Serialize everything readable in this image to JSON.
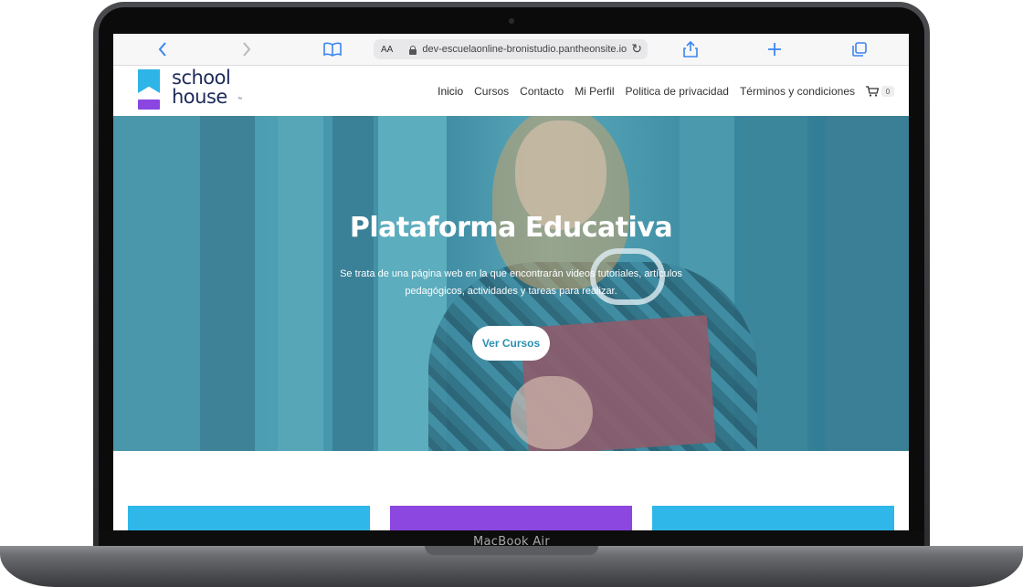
{
  "device": {
    "label": "MacBook Air"
  },
  "browser": {
    "text_size_label": "AA",
    "url": "dev-escuelaonline-bronistudio.pantheonsite.io"
  },
  "site": {
    "logo": {
      "line1": "school",
      "line2": "house",
      "tm": "™"
    },
    "nav": {
      "items": [
        {
          "label": "Inicio"
        },
        {
          "label": "Cursos"
        },
        {
          "label": "Contacto"
        },
        {
          "label": "Mi Perfil"
        },
        {
          "label": "Politica de privacidad"
        },
        {
          "label": "Términos y condiciones"
        }
      ],
      "cart_count": "0"
    },
    "hero": {
      "title": "Plataforma Educativa",
      "subtitle": "Se trata de una página web en la que encontrarán videos tutoriales, artículos pedagógicos, actividades y tareas para realizar.",
      "button_label": "Ver Cursos"
    },
    "cards": [
      {
        "color": "#2eb7e8"
      },
      {
        "color": "#8b47e0"
      },
      {
        "color": "#2eb7e8"
      }
    ]
  },
  "colors": {
    "brand_blue": "#2eb4e6",
    "brand_purple": "#8b46e2",
    "logo_text": "#1e2a5a",
    "browser_accent": "#3a86f0"
  }
}
